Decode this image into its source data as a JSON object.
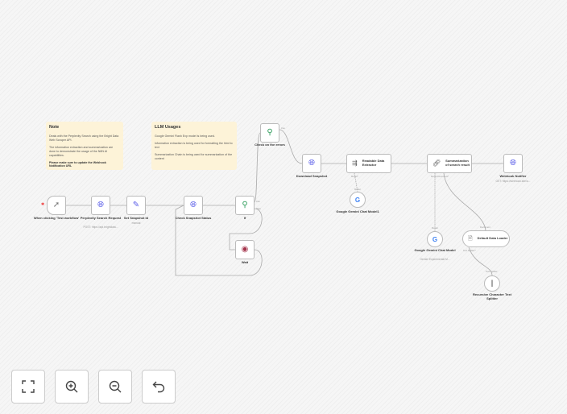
{
  "notes": [
    {
      "title": "Note",
      "lines": [
        "Deals with the Perplexity Search using the Bright Data Web Scraper API.",
        "The information extraction and summarization are done to demonstrate the usage of the N8N AI capabilities.",
        "Please make sure to update the Webhook Notification URL"
      ]
    },
    {
      "title": "LLM Usages",
      "lines": [
        "Google Gemini Flash Exp model is being used.",
        "Information extraction is being used for formatting the html to text",
        "Summarization Chain is being used for summarization of the content"
      ]
    }
  ],
  "nodes": {
    "trigger": {
      "label": "When clicking 'Test workflow'",
      "icon": "cursor-icon"
    },
    "perplexity": {
      "label": "Perplexity Search Request",
      "sub": "POST: https://api.brightdata...",
      "icon": "globe-icon"
    },
    "set": {
      "label": "Set Snapshot Id",
      "sub": "manual",
      "icon": "pencil-icon"
    },
    "check": {
      "label": "Check Snapshot Status",
      "icon": "globe-icon"
    },
    "if": {
      "label": "If",
      "icon": "signpost-icon",
      "ports": [
        "true",
        "false"
      ]
    },
    "wait": {
      "label": "Wait",
      "icon": "pause-icon"
    },
    "errors": {
      "label": "Check on the errors",
      "icon": "signpost-icon",
      "ports": [
        "true"
      ]
    },
    "download": {
      "label": "Download Snapshot",
      "icon": "globe-icon"
    },
    "extractor": {
      "label": "Readable Data Extractor",
      "icon": "extract-icon",
      "port": "Model*"
    },
    "gemini1": {
      "label": "Google Gemini Chat Model1",
      "port": "Model"
    },
    "summ": {
      "label": "Summarization of search result",
      "icon": "link-icon",
      "port": "Model  Document*"
    },
    "webhook": {
      "label": "Webhook Notifier",
      "sub": "GET: https://webhook.site/a...",
      "icon": "globe-icon"
    },
    "gemini2": {
      "label": "Google Gemini Chat Model",
      "sub": "Gemini Experimental M...",
      "port": "Model"
    },
    "loader": {
      "label": "Default Data Loader",
      "port_in": "Document",
      "port_out": "Text Splitter*"
    },
    "splitter": {
      "label": "Recursive Character Text Splitter",
      "port": "Text Splitter"
    }
  },
  "controls": [
    "fit-view",
    "zoom-in",
    "zoom-out",
    "undo"
  ],
  "colors": {
    "globe": "#5a5de8",
    "if": "#2e9c5b",
    "wait": "#a4334b"
  }
}
